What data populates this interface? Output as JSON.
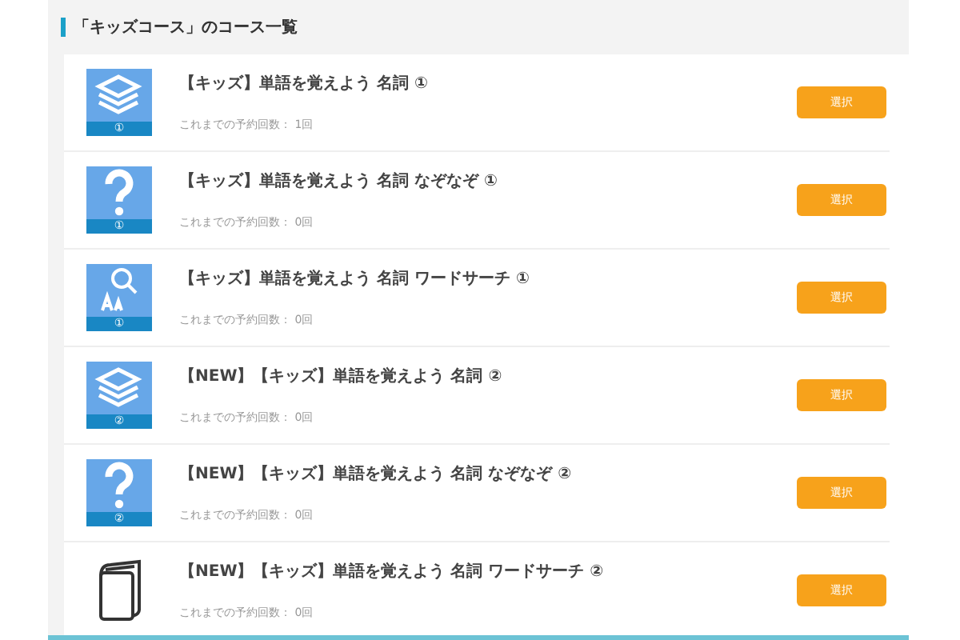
{
  "heading": "「キッズコース」のコース一覧",
  "courses": [
    {
      "kind": "stack",
      "badge": "①",
      "title": "【キッズ】単語を覚えよう 名詞 ①",
      "count": "これまでの予約回数： 1回",
      "button": "選択"
    },
    {
      "kind": "question",
      "badge": "①",
      "title": "【キッズ】単語を覚えよう 名詞 なぞなぞ ①",
      "count": "これまでの予約回数： 0回",
      "button": "選択"
    },
    {
      "kind": "search",
      "badge": "①",
      "title": "【キッズ】単語を覚えよう 名詞 ワードサーチ ①",
      "count": "これまでの予約回数： 0回",
      "button": "選択"
    },
    {
      "kind": "stack",
      "badge": "②",
      "title": "【NEW】【キッズ】単語を覚えよう 名詞 ②",
      "count": "これまでの予約回数： 0回",
      "button": "選択"
    },
    {
      "kind": "question",
      "badge": "②",
      "title": "【NEW】【キッズ】単語を覚えよう 名詞 なぞなぞ ②",
      "count": "これまでの予約回数： 0回",
      "button": "選択"
    },
    {
      "kind": "book",
      "title": "【NEW】【キッズ】単語を覚えよう 名詞 ワードサーチ ②",
      "count": "これまでの予約回数： 0回",
      "button": "選択"
    }
  ]
}
